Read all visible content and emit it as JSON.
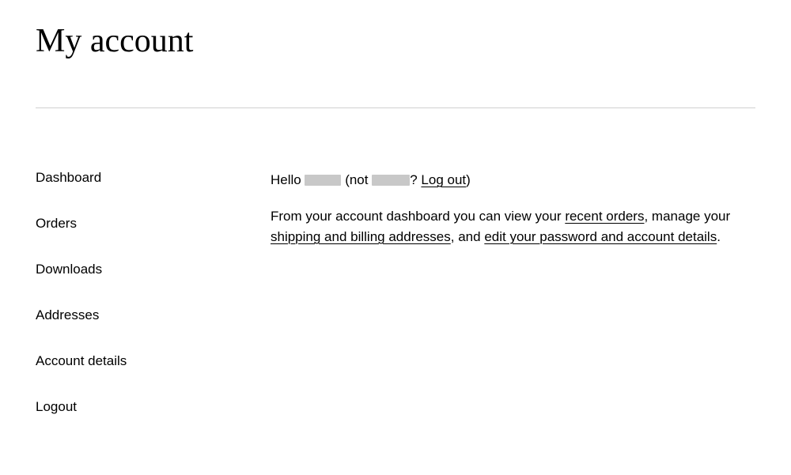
{
  "page_title": "My account",
  "sidebar": {
    "items": [
      {
        "label": "Dashboard"
      },
      {
        "label": "Orders"
      },
      {
        "label": "Downloads"
      },
      {
        "label": "Addresses"
      },
      {
        "label": "Account details"
      },
      {
        "label": "Logout"
      }
    ]
  },
  "greeting": {
    "hello": "Hello ",
    "not_prefix": " (not ",
    "question_mark": "? ",
    "logout_label": "Log out",
    "close_paren": ")"
  },
  "dashboard_text": {
    "part1": "From your account dashboard you can view your ",
    "link_orders": "recent orders",
    "part2": ", manage your ",
    "link_addresses": "shipping and billing addresses",
    "part3": ", and ",
    "link_account": "edit your password and account details",
    "part4": "."
  }
}
